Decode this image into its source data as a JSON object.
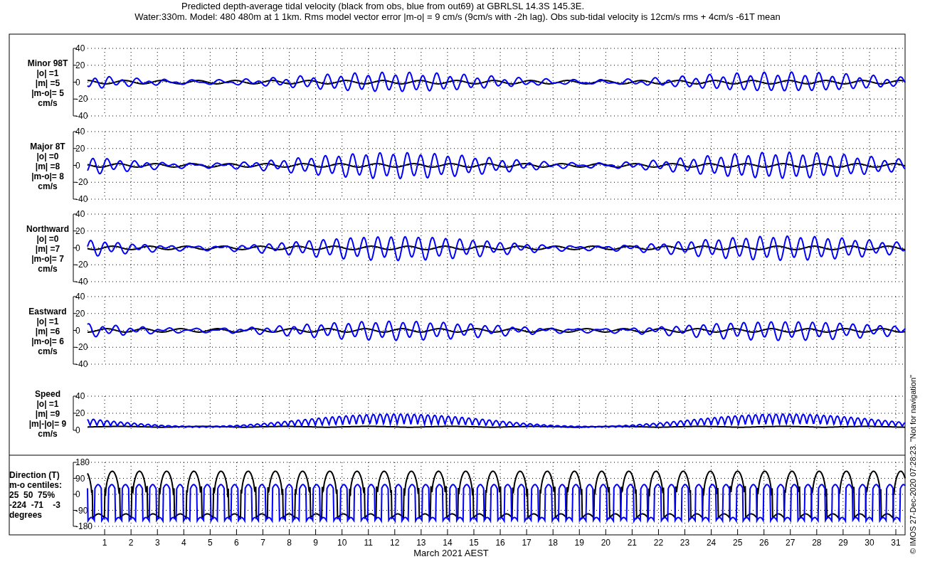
{
  "title": {
    "line_1": "Predicted depth-average tidal velocity (black from obs, blue from out69) at GBRLSL 14.3S 145.3E.",
    "line_2": "Water:330m. Model: 480 480m at 1 1km. Rms model vector error |m-o| = 9 cm/s (9cm/s with -2h lag). Obs sub-tidal velocity is 12cm/s rms + 4cm/s -61T mean"
  },
  "panels": [
    {
      "kind": "signed",
      "label_lines": [
        "Minor 98T",
        "|o| =1",
        "|m| =5",
        "|m-o|= 5",
        "cm/s"
      ],
      "yticks": [
        "40",
        "20",
        "0",
        "-20",
        "-40"
      ]
    },
    {
      "kind": "signed",
      "label_lines": [
        "Major 8T",
        "|o| =0",
        "|m| =8",
        "|m-o|= 8",
        "cm/s"
      ],
      "yticks": [
        "40",
        "20",
        "0",
        "-20",
        "-40"
      ]
    },
    {
      "kind": "signed",
      "label_lines": [
        "Northward",
        "|o| =0",
        "|m| =7",
        "|m-o|= 7",
        "cm/s"
      ],
      "yticks": [
        "40",
        "20",
        "0",
        "-20",
        "-40"
      ]
    },
    {
      "kind": "signed",
      "label_lines": [
        "Eastward",
        "|o| =1",
        "|m| =6",
        "|m-o|= 6",
        "cm/s"
      ],
      "yticks": [
        "40",
        "20",
        "0",
        "-20",
        "-40"
      ]
    },
    {
      "kind": "speed",
      "label_lines": [
        "Speed",
        "|o| =1",
        "|m| =9",
        "|m|-|o|= 9",
        "cm/s"
      ],
      "yticks": [
        "40",
        "20",
        "0"
      ]
    },
    {
      "kind": "direction",
      "label_lines": [
        "Direction (T)",
        "m-o centiles:",
        "25  50  75%",
        "-224  -71    -3",
        "degrees"
      ],
      "yticks": [
        "180",
        "90",
        "0",
        "-90",
        "-180"
      ]
    }
  ],
  "x_axis": {
    "day_labels": [
      "1",
      "2",
      "3",
      "4",
      "5",
      "6",
      "7",
      "8",
      "9",
      "10",
      "11",
      "12",
      "13",
      "14",
      "15",
      "16",
      "17",
      "18",
      "19",
      "20",
      "21",
      "22",
      "23",
      "24",
      "25",
      "26",
      "27",
      "28",
      "29",
      "30",
      "31"
    ],
    "label": "March 2021 AEST"
  },
  "credit": "© IMOS 27-Dec-2020 07:28:23. \"Not for navigation\""
}
